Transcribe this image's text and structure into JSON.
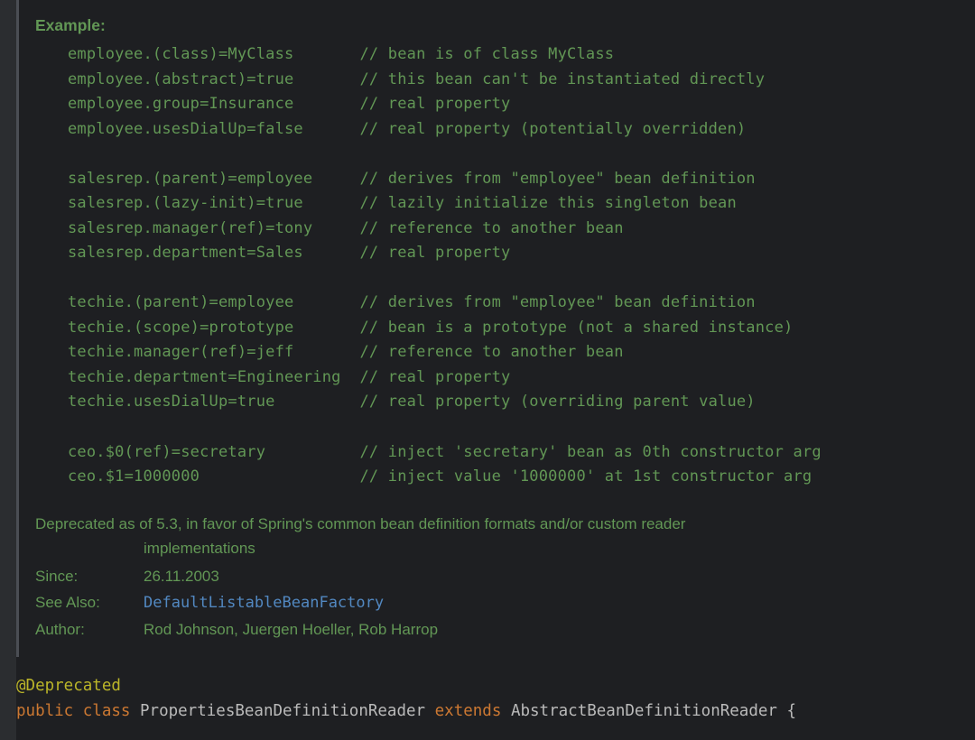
{
  "example_header": "Example:",
  "code_text": "employee.(class)=MyClass       // bean is of class MyClass\nemployee.(abstract)=true       // this bean can't be instantiated directly\nemployee.group=Insurance       // real property\nemployee.usesDialUp=false      // real property (potentially overridden)\n\nsalesrep.(parent)=employee     // derives from \"employee\" bean definition\nsalesrep.(lazy-init)=true      // lazily initialize this singleton bean\nsalesrep.manager(ref)=tony     // reference to another bean\nsalesrep.department=Sales      // real property\n\ntechie.(parent)=employee       // derives from \"employee\" bean definition\ntechie.(scope)=prototype       // bean is a prototype (not a shared instance)\ntechie.manager(ref)=jeff       // reference to another bean\ntechie.department=Engineering  // real property\ntechie.usesDialUp=true         // real property (overriding parent value)\n\nceo.$0(ref)=secretary          // inject 'secretary' bean as 0th constructor arg\nceo.$1=1000000                 // inject value '1000000' at 1st constructor arg",
  "meta": {
    "deprecated_label": "Deprecated",
    "deprecated_line1": " as of 5.3, in favor of Spring's common bean definition formats and/or custom reader",
    "deprecated_line2": "implementations",
    "since_label": "Since:",
    "since_value": "26.11.2003",
    "see_also_label": "See Also:",
    "see_also_value": "DefaultListableBeanFactory",
    "author_label": "Author:",
    "author_value": "Rod Johnson, Juergen Hoeller, Rob Harrop"
  },
  "source": {
    "annotation": "@Deprecated",
    "kw_public": "public",
    "kw_class": "class",
    "class_name": "PropertiesBeanDefinitionReader",
    "kw_extends": "extends",
    "super_name": "AbstractBeanDefinitionReader",
    "brace": "{"
  }
}
